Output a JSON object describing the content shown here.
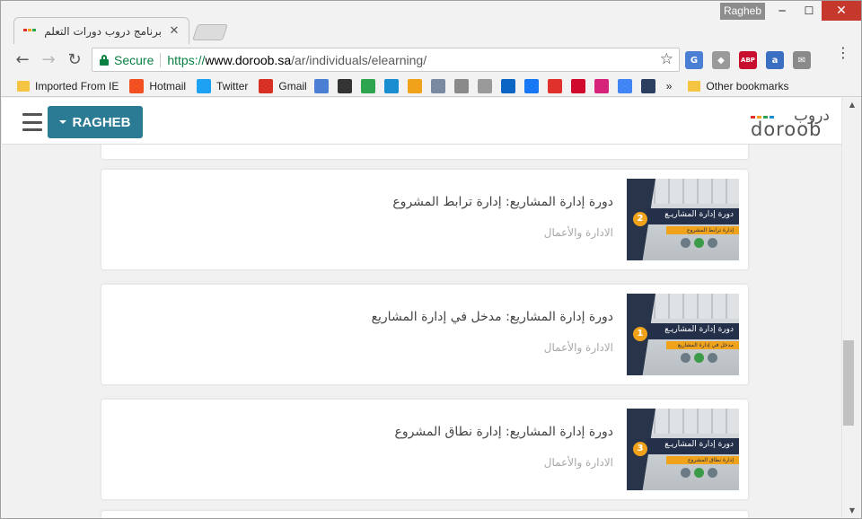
{
  "browser": {
    "tab_title": "برنامج دروب دورات التعلم الإلكتروني",
    "tab_close": "✕",
    "profile_name": "Ragheb",
    "window_min": "─",
    "window_max": "☐",
    "window_close": "✕",
    "back": "←",
    "forward": "→",
    "reload": "↻",
    "secure_label": "Secure",
    "url_scheme": "https://",
    "url_host": "www.doroob.sa",
    "url_path": "/ar/individuals/elearning/",
    "star": "☆",
    "menu": "⋮",
    "extensions": [
      {
        "name": "translate-icon",
        "label": "G",
        "color": "#4a7fd4"
      },
      {
        "name": "clip-icon",
        "label": "◆",
        "color": "#9a9a9a"
      },
      {
        "name": "adblock-icon",
        "label": "ABP",
        "color": "#c8102e"
      },
      {
        "name": "download-icon",
        "label": "a",
        "color": "#3b6fc1"
      },
      {
        "name": "mail-icon",
        "label": "✉",
        "color": "#8a8a8a"
      }
    ],
    "adblock_count": "1"
  },
  "bookmarks": {
    "items": [
      {
        "name": "bookmark-imported-from-ie",
        "label": "Imported From IE",
        "icon": "folder-icon",
        "color": "#f5c443"
      },
      {
        "name": "bookmark-hotmail",
        "label": "Hotmail",
        "icon": "windows-icon",
        "color": "#f25022"
      },
      {
        "name": "bookmark-twitter",
        "label": "Twitter",
        "icon": "twitter-icon",
        "color": "#1da1f2"
      },
      {
        "name": "bookmark-gmail",
        "label": "Gmail",
        "icon": "gmail-icon",
        "color": "#d93025"
      },
      {
        "name": "bookmark-translate",
        "label": "",
        "icon": "translate-icon",
        "color": "#4a7fd4"
      },
      {
        "name": "bookmark-wikipedia",
        "label": "",
        "icon": "wikipedia-icon",
        "color": "#333333"
      },
      {
        "name": "bookmark-green-one",
        "label": "",
        "icon": "circle-one-icon",
        "color": "#2da44e"
      },
      {
        "name": "bookmark-arrows",
        "label": "",
        "icon": "arrows-icon",
        "color": "#1a8dd1"
      },
      {
        "name": "bookmark-info",
        "label": "",
        "icon": "info-icon",
        "color": "#f0a21a"
      },
      {
        "name": "bookmark-db",
        "label": "",
        "icon": "database-icon",
        "color": "#7a8aa0"
      },
      {
        "name": "bookmark-calendar",
        "label": "",
        "icon": "calendar-icon",
        "color": "#8a8a8a"
      },
      {
        "name": "bookmark-page",
        "label": "",
        "icon": "page-icon",
        "color": "#9a9a9a"
      },
      {
        "name": "bookmark-linkedin",
        "label": "",
        "icon": "linkedin-icon",
        "color": "#0a66c2"
      },
      {
        "name": "bookmark-facebook",
        "label": "",
        "icon": "facebook-icon",
        "color": "#1877f2"
      },
      {
        "name": "bookmark-red-circle",
        "label": "",
        "icon": "red-circle-icon",
        "color": "#e0312b"
      },
      {
        "name": "bookmark-huawei",
        "label": "",
        "icon": "huawei-icon",
        "color": "#cf0a2c"
      },
      {
        "name": "bookmark-idx",
        "label": "",
        "icon": "idx-icon",
        "color": "#d6247a"
      },
      {
        "name": "bookmark-google",
        "label": "",
        "icon": "google-icon",
        "color": "#4285f4"
      },
      {
        "name": "bookmark-m",
        "label": "",
        "icon": "m-icon",
        "color": "#2c3e60"
      }
    ],
    "overflow": "»",
    "other_label": "Other bookmarks"
  },
  "site": {
    "user_button": "RAGHEB",
    "logo_ar": "دروب",
    "logo_en": "doroob",
    "logo_colors": [
      "#e0312b",
      "#f0a21a",
      "#2da44e",
      "#1a8dd1"
    ]
  },
  "courses": [
    {
      "title": "دورة إدارة المشاريع: إدارة ترابط المشروع",
      "category": "الادارة والأعمال",
      "thumb_title": "دورة إدارة المشاريـع",
      "thumb_sub": "إدارة ترابط المشروع",
      "number": "2"
    },
    {
      "title": "دورة إدارة المشاريع: مدخل في إدارة المشاريع",
      "category": "الادارة والأعمال",
      "thumb_title": "دورة إدارة المشاريـع",
      "thumb_sub": "مدخل في إدارة المشاريع",
      "number": "1"
    },
    {
      "title": "دورة إدارة المشاريع: إدارة نطاق المشروع",
      "category": "الادارة والأعمال",
      "thumb_title": "دورة إدارة المشاريـع",
      "thumb_sub": "إدارة نطاق المشروع",
      "number": "3"
    }
  ],
  "scrollbar": {
    "up": "▲",
    "down": "▼"
  }
}
